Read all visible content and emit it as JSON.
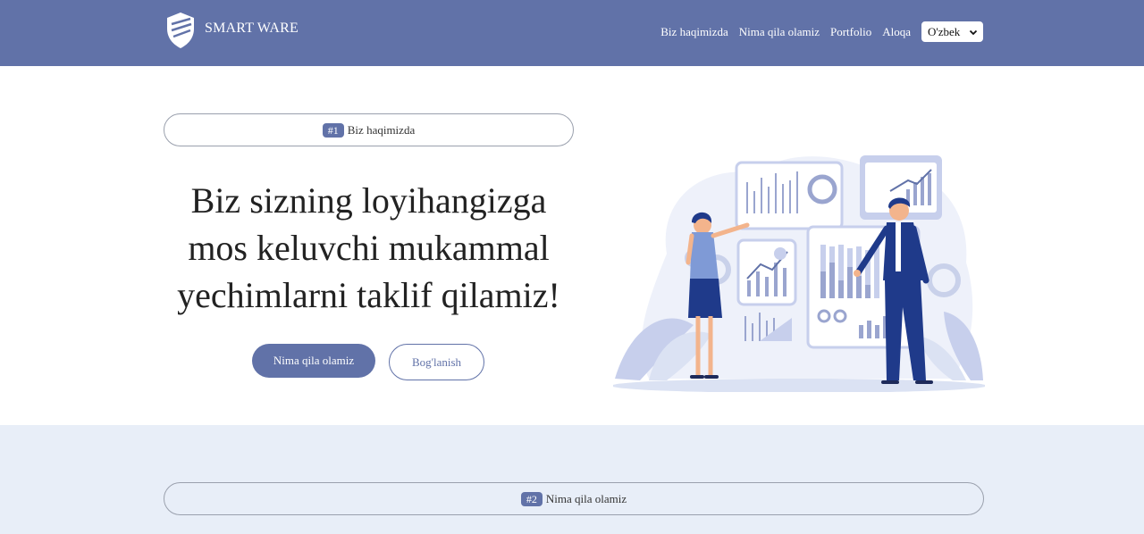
{
  "header": {
    "brand": "SMART WARE",
    "nav": [
      "Biz haqimizda",
      "Nima qila olamiz",
      "Portfolio",
      "Aloqa"
    ],
    "language": "O'zbek"
  },
  "hero": {
    "section_badge": "#1",
    "section_label": "Biz haqimizda",
    "title_lines": [
      "Biz sizning loyihangizga",
      "mos keluvchi mukammal",
      "yechimlarni taklif qilamiz!"
    ],
    "primary_button": "Nima qila olamiz",
    "secondary_button": "Bog'lanish"
  },
  "section2": {
    "section_badge": "#2",
    "section_label": "Nima qila olamiz"
  },
  "colors": {
    "brand": "#6172a8",
    "section_bg": "#e8eef8",
    "illustration_dark": "#1f3a8a",
    "illustration_light": "#dbe2f3"
  }
}
